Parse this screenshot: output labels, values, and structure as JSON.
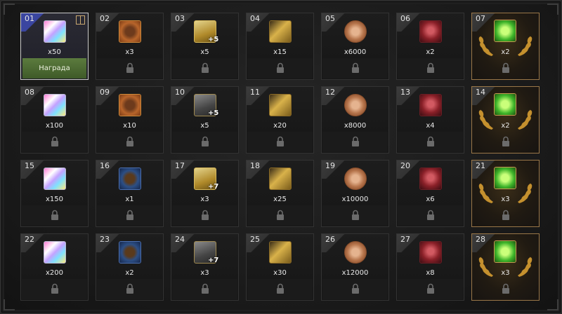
{
  "rewards": [
    {
      "num": "01",
      "qty": "x50",
      "icon": "prism-crystal-icon",
      "state": "claimable",
      "claim_label": "Награда"
    },
    {
      "num": "02",
      "qty": "x3",
      "icon": "orange-tome-icon",
      "state": "locked"
    },
    {
      "num": "03",
      "qty": "x5",
      "icon": "upgrade-scroll-icon",
      "plus": "+5",
      "state": "locked"
    },
    {
      "num": "04",
      "qty": "x15",
      "icon": "golden-hammer-icon",
      "state": "locked"
    },
    {
      "num": "05",
      "qty": "x6000",
      "icon": "bronze-coin-icon",
      "state": "locked"
    },
    {
      "num": "06",
      "qty": "x2",
      "icon": "red-relic-icon",
      "state": "locked"
    },
    {
      "num": "07",
      "qty": "x2",
      "icon": "green-scroll-icon",
      "state": "big"
    },
    {
      "num": "08",
      "qty": "x100",
      "icon": "prism-crystal-icon",
      "state": "locked"
    },
    {
      "num": "09",
      "qty": "x10",
      "icon": "orange-tome-icon",
      "state": "locked"
    },
    {
      "num": "10",
      "qty": "x5",
      "icon": "dark-scroll-icon",
      "plus": "+5",
      "state": "locked"
    },
    {
      "num": "11",
      "qty": "x20",
      "icon": "golden-hammer-icon",
      "state": "locked"
    },
    {
      "num": "12",
      "qty": "x8000",
      "icon": "bronze-coin-icon",
      "state": "locked"
    },
    {
      "num": "13",
      "qty": "x4",
      "icon": "red-relic-icon",
      "state": "locked"
    },
    {
      "num": "14",
      "qty": "x2",
      "icon": "green-scroll-icon",
      "state": "big"
    },
    {
      "num": "15",
      "qty": "x150",
      "icon": "prism-crystal-icon",
      "state": "locked"
    },
    {
      "num": "16",
      "qty": "x1",
      "icon": "blue-tome-icon",
      "state": "locked"
    },
    {
      "num": "17",
      "qty": "x3",
      "icon": "upgrade-scroll-icon",
      "plus": "+7",
      "state": "locked"
    },
    {
      "num": "18",
      "qty": "x25",
      "icon": "golden-hammer-icon",
      "state": "locked"
    },
    {
      "num": "19",
      "qty": "x10000",
      "icon": "bronze-coin-icon",
      "state": "locked"
    },
    {
      "num": "20",
      "qty": "x6",
      "icon": "red-relic-icon",
      "state": "locked"
    },
    {
      "num": "21",
      "qty": "x3",
      "icon": "green-scroll-icon",
      "state": "big"
    },
    {
      "num": "22",
      "qty": "x200",
      "icon": "prism-crystal-icon",
      "state": "locked"
    },
    {
      "num": "23",
      "qty": "x2",
      "icon": "blue-tome-icon",
      "state": "locked"
    },
    {
      "num": "24",
      "qty": "x3",
      "icon": "dark-scroll-icon",
      "plus": "+7",
      "state": "locked"
    },
    {
      "num": "25",
      "qty": "x30",
      "icon": "golden-hammer-icon",
      "state": "locked"
    },
    {
      "num": "26",
      "qty": "x12000",
      "icon": "bronze-coin-icon",
      "state": "locked"
    },
    {
      "num": "27",
      "qty": "x8",
      "icon": "red-relic-icon",
      "state": "locked"
    },
    {
      "num": "28",
      "qty": "x3",
      "icon": "green-scroll-icon",
      "state": "big"
    }
  ]
}
